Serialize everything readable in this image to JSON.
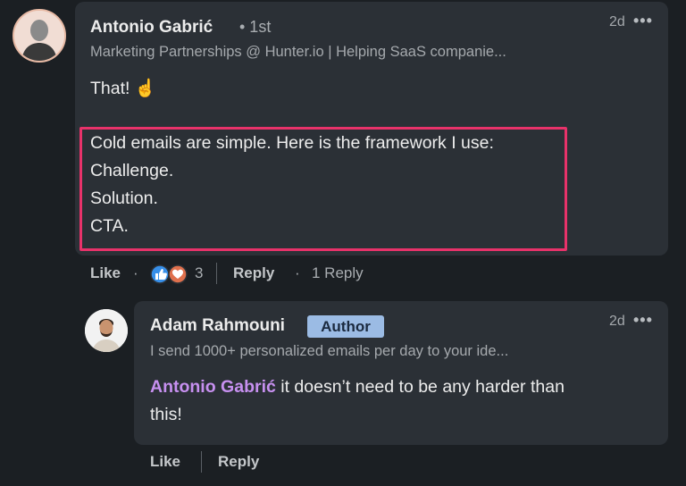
{
  "comment": {
    "author_name": "Antonio Gabrić",
    "connection_degree": "• 1st",
    "headline": "Marketing Partnerships @ Hunter.io | Helping SaaS companie...",
    "time_ago": "2d",
    "more_label": "•••",
    "line_intro": "That! ☝️",
    "highlighted_lines": [
      "Cold emails are simple. Here is the framework I use:",
      "Challenge.",
      "Solution.",
      "CTA."
    ],
    "actions": {
      "like_label": "Like",
      "dot": "·",
      "reaction_count": "3",
      "reply_label": "Reply",
      "reply_count_label": "1 Reply"
    }
  },
  "reply": {
    "author_name": "Adam Rahmouni",
    "author_badge": "Author",
    "headline": "I send 1000+ personalized emails per day to your ide...",
    "time_ago": "2d",
    "more_label": "•••",
    "mention": "Antonio Gabrić",
    "text_line1": " it doesn’t need to be any harder than",
    "text_line2": "this!",
    "actions": {
      "like_label": "Like",
      "reply_label": "Reply"
    }
  },
  "colors": {
    "background": "#1b1f23",
    "bubble": "#2b3036",
    "highlight_border": "#e8326a",
    "mention": "#c790f0",
    "author_badge": "#9bbbe4",
    "like_reaction": "#378fe9",
    "love_reaction": "#df704d"
  },
  "icons": [
    "like-reaction-icon",
    "love-reaction-icon",
    "more-options-icon",
    "avatar-photo"
  ]
}
